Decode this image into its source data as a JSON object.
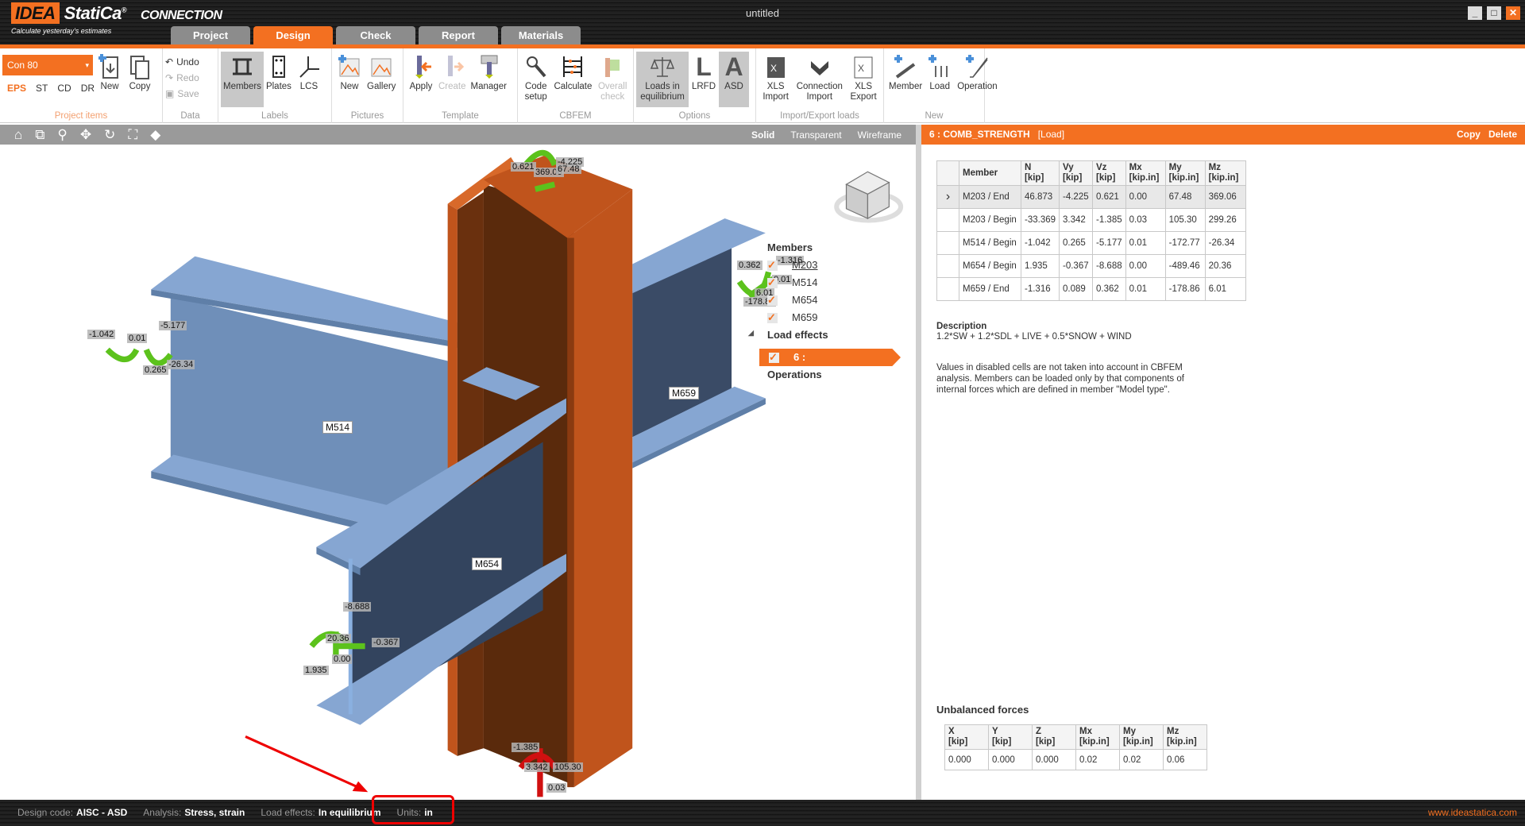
{
  "app": {
    "brand": "IDEA StatiCa",
    "product": "CONNECTION",
    "slogan": "Calculate yesterday's estimates",
    "title": "untitled"
  },
  "window_controls": [
    "minimize",
    "maximize",
    "close"
  ],
  "tabs": [
    {
      "label": "Project"
    },
    {
      "label": "Design",
      "active": true
    },
    {
      "label": "Check"
    },
    {
      "label": "Report"
    },
    {
      "label": "Materials"
    }
  ],
  "ribbon": {
    "project_items": {
      "label": "Project items",
      "selected_connection": "Con 80",
      "codes": [
        "EPS",
        "ST",
        "CD",
        "DR"
      ],
      "active_code": "EPS",
      "new": "New",
      "copy": "Copy"
    },
    "data": {
      "label": "Data",
      "undo": "Undo",
      "redo": "Redo",
      "save": "Save"
    },
    "labels": {
      "label": "Labels",
      "members": "Members",
      "plates": "Plates",
      "lcs": "LCS"
    },
    "pictures": {
      "label": "Pictures",
      "new": "New",
      "gallery": "Gallery"
    },
    "template": {
      "label": "Template",
      "apply": "Apply",
      "create": "Create",
      "manager": "Manager"
    },
    "cbfem": {
      "label": "CBFEM",
      "code_setup": "Code setup",
      "calculate": "Calculate",
      "overall_check": "Overall check"
    },
    "options": {
      "label": "Options",
      "loads_in_equilibrium": "Loads in equilibrium",
      "lrfd": "LRFD",
      "asd": "ASD"
    },
    "import_export": {
      "label": "Import/Export loads",
      "xls_import": "XLS Import",
      "connection_import": "Connection Import",
      "xls_export": "XLS Export"
    },
    "new": {
      "label": "New",
      "member": "Member",
      "load": "Load",
      "operation": "Operation"
    }
  },
  "viewport": {
    "modes": [
      "Solid",
      "Transparent",
      "Wireframe"
    ],
    "active_mode": "Solid",
    "tools": [
      "home-icon",
      "zoom-window-icon",
      "zoom-icon",
      "pan-icon",
      "rotate-icon",
      "fit-icon",
      "view-cube-icon"
    ],
    "member_labels": [
      "M514",
      "M659",
      "M654"
    ],
    "load_labels": [
      "0.621",
      "-4.225",
      "369.06",
      "67.48",
      "-1.042",
      "0.01",
      "-5.177",
      "0.265",
      "-26.34",
      "0.362",
      "-1.316",
      "0.01",
      "6.01",
      "-178.86",
      "-8.688",
      "20.36",
      "-0.367",
      "0.00",
      "1.935",
      "-1.385",
      "3.342",
      "105.30",
      "0.03"
    ]
  },
  "tree": {
    "members_header": "Members",
    "members": [
      "M203",
      "M514",
      "M654",
      "M659"
    ],
    "load_effects_header": "Load effects",
    "load_effect": "6 : COMB_STRENGTH",
    "operations_header": "Operations"
  },
  "panel": {
    "header": "6 : COMB_STRENGTH",
    "header_tag": "[Load]",
    "copy": "Copy",
    "delete": "Delete",
    "columns": [
      "Member",
      "N [kip]",
      "Vy [kip]",
      "Vz [kip]",
      "Mx [kip.in]",
      "My [kip.in]",
      "Mz [kip.in]"
    ],
    "rows": [
      [
        "M203 / End",
        "46.873",
        "-4.225",
        "0.621",
        "0.00",
        "67.48",
        "369.06"
      ],
      [
        "M203 / Begin",
        "-33.369",
        "3.342",
        "-1.385",
        "0.03",
        "105.30",
        "299.26"
      ],
      [
        "M514 / Begin",
        "-1.042",
        "0.265",
        "-5.177",
        "0.01",
        "-172.77",
        "-26.34"
      ],
      [
        "M654 / Begin",
        "1.935",
        "-0.367",
        "-8.688",
        "0.00",
        "-489.46",
        "20.36"
      ],
      [
        "M659 / End",
        "-1.316",
        "0.089",
        "0.362",
        "0.01",
        "-178.86",
        "6.01"
      ]
    ],
    "description_label": "Description",
    "description": "1.2*SW + 1.2*SDL + LIVE + 0.5*SNOW + WIND",
    "note": "Values in disabled cells are not taken into account in CBFEM analysis. Members can be loaded only by that components of internal forces which are defined in member \"Model type\".",
    "unbalanced_title": "Unbalanced forces",
    "unbalanced_columns": [
      "X [kip]",
      "Y [kip]",
      "Z [kip]",
      "Mx [kip.in]",
      "My [kip.in]",
      "Mz [kip.in]"
    ],
    "unbalanced_values": [
      "0.000",
      "0.000",
      "0.000",
      "0.02",
      "0.02",
      "0.06"
    ]
  },
  "status": {
    "design_code_label": "Design code:",
    "design_code": "AISC - ASD",
    "analysis_label": "Analysis:",
    "analysis": "Stress, strain",
    "load_effects_label": "Load effects:",
    "load_effects": "In equilibrium",
    "units_label": "Units:",
    "units": "in",
    "website": "www.ideastatica.com"
  },
  "colors": {
    "accent": "#f37021",
    "column": "#c0541c",
    "beam": "#7b9cc9",
    "beam_dark": "#33445e",
    "load_green": "#5cc21c",
    "load_red": "#d01010",
    "annotation": "#e00000"
  }
}
